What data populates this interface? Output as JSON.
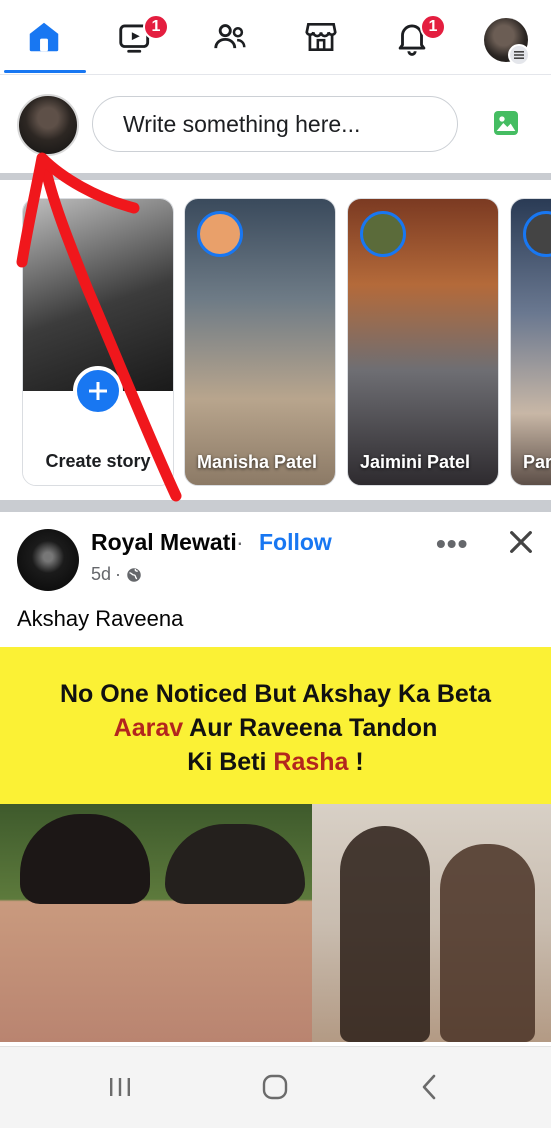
{
  "nav": {
    "watch_badge": "1",
    "notifications_badge": "1",
    "accent": "#1877f2"
  },
  "composer": {
    "placeholder": "Write something here..."
  },
  "stories": {
    "create_label": "Create story",
    "items": [
      {
        "name": "Manisha Patel"
      },
      {
        "name": "Jaimini Patel"
      },
      {
        "name": "Par"
      }
    ]
  },
  "post": {
    "author": "Royal Mewati",
    "separator": " · ",
    "follow_label": "Follow",
    "time": "5d",
    "dot": "·",
    "more_label": "•••",
    "text": "Akshay Raveena",
    "banner": {
      "line1": "No One Noticed But Akshay Ka Beta",
      "line2_red": "Aarav",
      "line2_rest": " Aur Raveena Tandon",
      "line3_start": "Ki Beti ",
      "line3_red": "Rasha",
      "line3_end": " !"
    }
  },
  "icons": {
    "home": "home-icon",
    "watch": "video-icon",
    "friends": "friends-icon",
    "marketplace": "marketplace-icon",
    "notifications": "bell-icon",
    "menu": "menu-icon"
  }
}
